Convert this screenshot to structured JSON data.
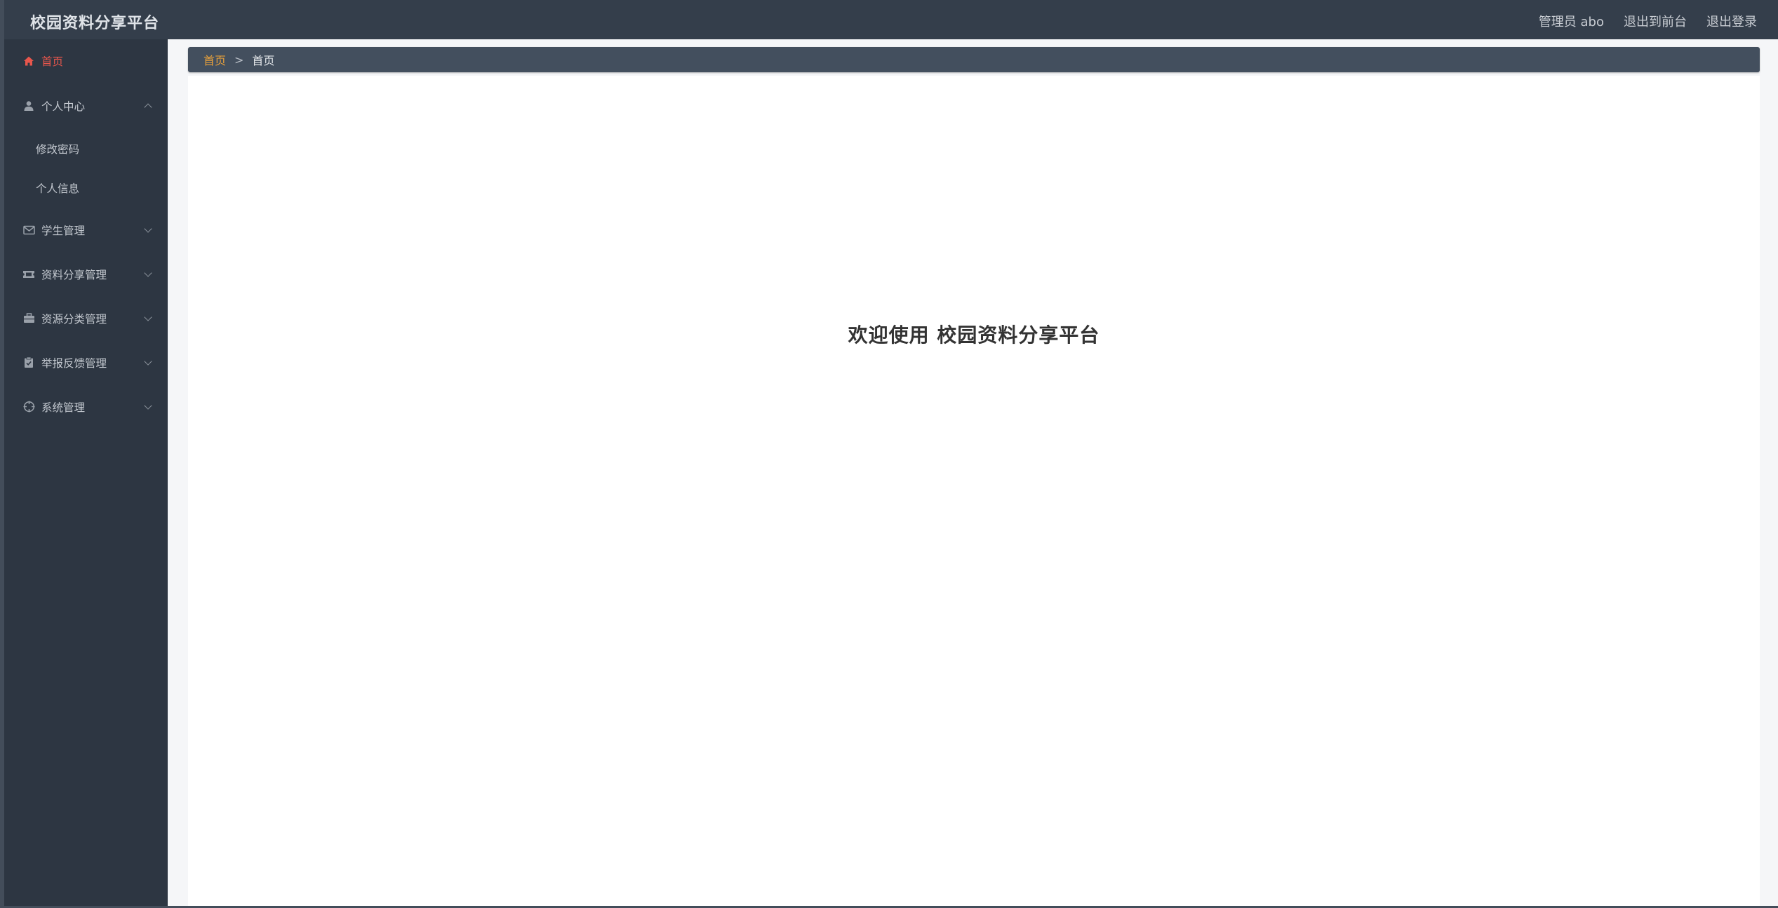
{
  "header": {
    "brand": "校园资料分享平台",
    "user_label": "管理员 abo",
    "to_front_label": "退出到前台",
    "logout_label": "退出登录"
  },
  "sidebar": {
    "items": [
      {
        "label": "首页",
        "icon": "home-icon",
        "active": true
      },
      {
        "label": "个人中心",
        "icon": "user-icon",
        "expanded": true,
        "children": [
          {
            "label": "修改密码"
          },
          {
            "label": "个人信息"
          }
        ]
      },
      {
        "label": "学生管理",
        "icon": "envelope-icon"
      },
      {
        "label": "资料分享管理",
        "icon": "ticket-icon"
      },
      {
        "label": "资源分类管理",
        "icon": "briefcase-icon"
      },
      {
        "label": "举报反馈管理",
        "icon": "clipboard-icon"
      },
      {
        "label": "系统管理",
        "icon": "crosshair-icon"
      }
    ]
  },
  "breadcrumb": {
    "link": "首页",
    "separator": ">",
    "current": "首页"
  },
  "main": {
    "welcome": "欢迎使用 校园资料分享平台"
  },
  "colors": {
    "topbar": "#343e4b",
    "sidebar": "#2d3642",
    "active": "#e8564c",
    "breadcrumb_bg": "#434f5e",
    "breadcrumb_link": "#e9a13b"
  }
}
